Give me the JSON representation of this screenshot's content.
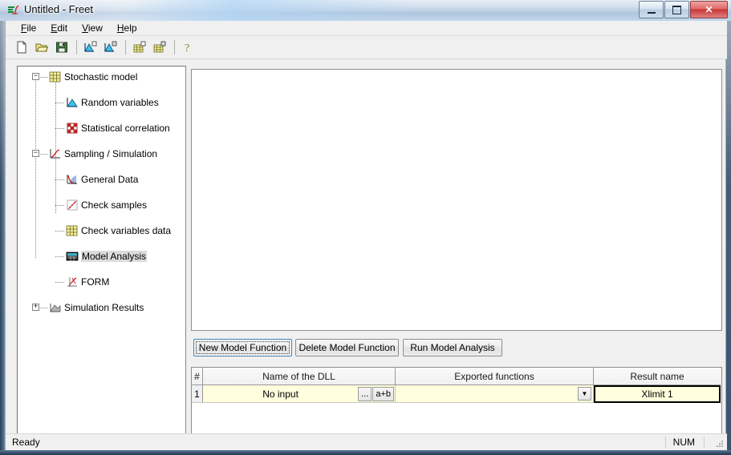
{
  "window": {
    "title": "Untitled - Freet",
    "app_icon": "freet-app-icon",
    "controls": {
      "minimize": "Minimize",
      "maximize": "Maximize",
      "close": "Close",
      "close_glyph": "✕"
    }
  },
  "menubar": {
    "items": [
      {
        "label": "File",
        "accel": "F",
        "rest": "ile"
      },
      {
        "label": "Edit",
        "accel": "E",
        "rest": "dit"
      },
      {
        "label": "View",
        "accel": "V",
        "rest": "iew"
      },
      {
        "label": "Help",
        "accel": "H",
        "rest": "elp"
      }
    ]
  },
  "toolbar": {
    "buttons": [
      {
        "name": "new-document-icon",
        "tooltip": "New"
      },
      {
        "name": "open-folder-icon",
        "tooltip": "Open"
      },
      {
        "name": "save-disk-icon",
        "tooltip": "Save"
      },
      {
        "name": "random-variables-add-icon",
        "tooltip": "Random variables"
      },
      {
        "name": "random-variables-edit-icon",
        "tooltip": "Edit random variables"
      },
      {
        "name": "grid-add-icon",
        "tooltip": "Add grid data"
      },
      {
        "name": "grid-edit-icon",
        "tooltip": "Edit grid data"
      },
      {
        "name": "help-question-icon",
        "tooltip": "Help"
      }
    ]
  },
  "tree": {
    "nodes": [
      {
        "label": "Stochastic model",
        "level": 0,
        "expander": "−",
        "icon": "yellow-grid-icon",
        "selected": false
      },
      {
        "label": "Random variables",
        "level": 1,
        "expander": "",
        "icon": "cyan-curve-icon",
        "selected": false
      },
      {
        "label": "Statistical correlation",
        "level": 1,
        "expander": "",
        "icon": "red-checker-grid-icon",
        "selected": false
      },
      {
        "label": "Sampling / Simulation",
        "level": 0,
        "expander": "−",
        "icon": "red-curve-axes-icon",
        "selected": false
      },
      {
        "label": "General Data",
        "level": 1,
        "expander": "",
        "icon": "blue-red-curve-icon",
        "selected": false
      },
      {
        "label": "Check samples",
        "level": 1,
        "expander": "",
        "icon": "scatter-line-icon",
        "selected": false
      },
      {
        "label": "Check variables data",
        "level": 1,
        "expander": "",
        "icon": "yellow-grid-icon",
        "selected": false
      },
      {
        "label": "Model Analysis",
        "level": 1,
        "expander": "",
        "icon": "monitor-table-icon",
        "selected": true
      },
      {
        "label": "FORM",
        "level": 1,
        "expander": "",
        "icon": "form-axes-icon",
        "selected": false
      },
      {
        "label": "Simulation Results",
        "level": 0,
        "expander": "+",
        "icon": "gray-histogram-icon",
        "selected": false
      }
    ]
  },
  "actions": {
    "new_model_function": "New Model Function",
    "delete_model_function": "Delete Model Function",
    "run_model_analysis": "Run Model Analysis",
    "focused_button": "New Model Function"
  },
  "grid": {
    "columns": [
      {
        "key": "index",
        "label": "#"
      },
      {
        "key": "dll",
        "label": "Name of the DLL"
      },
      {
        "key": "exported",
        "label": "Exported functions"
      },
      {
        "key": "result",
        "label": "Result name"
      }
    ],
    "rows": [
      {
        "index": "1",
        "dll": "No input",
        "dll_browse_button": "...",
        "dll_expr_button": "a+b",
        "exported": "",
        "exported_dropdown": "▼",
        "result": "Xlimit 1"
      }
    ],
    "row_background": "#ffffdd",
    "focused_cell": "result"
  },
  "statusbar": {
    "message": "Ready",
    "indicator_num": "NUM"
  }
}
